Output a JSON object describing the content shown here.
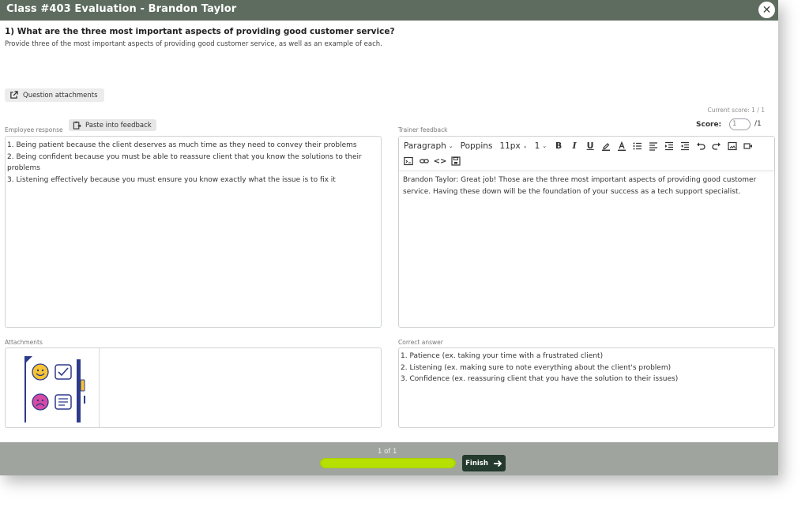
{
  "window": {
    "title": "Class #403 Evaluation - Brandon Taylor"
  },
  "question": {
    "number": "1)",
    "title": "What are the three most important aspects of providing good customer service?",
    "description": "Provide three of the most important aspects of providing good customer service, as well as an example of each.",
    "attachments_button": "Question attachments"
  },
  "score": {
    "current_label": "Current score: 1 / 1",
    "label": "Score:",
    "value": "1",
    "max": "/1"
  },
  "employee": {
    "label": "Employee response",
    "paste_button": "Paste into feedback",
    "lines": [
      "1. Being patient because the client deserves as much time as they need to convey their problems",
      "2. Being confident because you must be able to reassure client that you know the solutions to their problems",
      "3. Listening effectively because you must ensure you know exactly what the issue is to fix it"
    ]
  },
  "feedback": {
    "label": "Trainer feedback",
    "toolbar": {
      "paragraph": "Paragraph",
      "font": "Poppins",
      "size": "11px",
      "line_height": "1"
    },
    "text": "Brandon Taylor: Great job! Those are the three most important aspects of providing good customer service. Having these down will be the foundation of your success as a tech support specialist."
  },
  "attachments": {
    "label": "Attachments"
  },
  "correct": {
    "label": "Correct answer",
    "lines": [
      "1. Patience (ex. taking your time with a frustrated client)",
      "2. Listening (ex. making sure to note everything about the client's problem)",
      "3. Confidence (ex. reassuring client that you have the solution to their issues)"
    ]
  },
  "footer": {
    "page_indicator": "1 of 1",
    "progress": 1.0,
    "finish_label": "Finish"
  },
  "colors": {
    "titlebar": "#5d6c5f",
    "footer": "#9fa49f",
    "progress": "#b5e000",
    "finish": "#233a2c"
  }
}
